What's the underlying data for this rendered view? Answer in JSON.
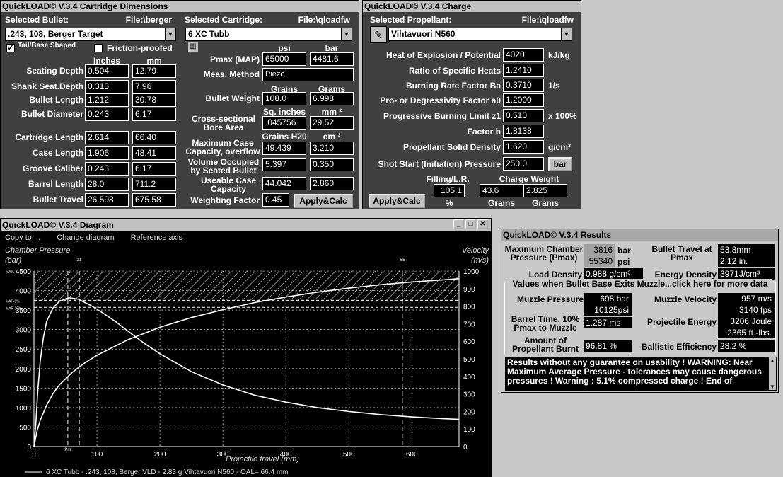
{
  "cartridge_window": {
    "title": "QuickLOAD© V.3.4 Cartridge Dimensions",
    "selected_bullet_label": "Selected Bullet:",
    "bullet_file": "File:\\berger",
    "bullet_value": ".243, 108, Berger Target",
    "tail_base_label": "Tail/Base Shaped",
    "tail_base_checked": "✓",
    "friction_label": "Friction-proofed",
    "col_inches": "Inches",
    "col_mm": "mm",
    "rows": [
      {
        "label": "Seating Depth",
        "in": "0.504",
        "mm": "12.79"
      },
      {
        "label": "Shank Seat.Depth",
        "in": "0.313",
        "mm": "7.96"
      },
      {
        "label": "Bullet Length",
        "in": "1.212",
        "mm": "30.78"
      },
      {
        "label": "Bullet Diameter",
        "in": "0.243",
        "mm": "6.17"
      },
      {
        "label": "Cartridge Length",
        "in": "2.614",
        "mm": "66.40"
      },
      {
        "label": "Case Length",
        "in": "1.906",
        "mm": "48.41"
      },
      {
        "label": "Groove Caliber",
        "in": "0.243",
        "mm": "6.17"
      },
      {
        "label": "Barrel Length",
        "in": "28.0",
        "mm": "711.2"
      },
      {
        "label": "Bullet Travel",
        "in": "26.598",
        "mm": "675.58"
      }
    ],
    "selected_cartridge_label": "Selected Cartridge:",
    "cartridge_file": "File:\\qloadfw",
    "cartridge_value": "6 XC Tubb",
    "col_psi": "psi",
    "col_bar": "bar",
    "pmax_label": "Pmax (MAP)",
    "pmax_psi": "65000",
    "pmax_bar": "4481.6",
    "meas_label": "Meas. Method",
    "meas_value": "Piezo",
    "col_grains": "Grains",
    "col_grams": "Grams",
    "bw_label": "Bullet Weight",
    "bw_grains": "108.0",
    "bw_grams": "6.998",
    "col_sqin": "Sq. inches",
    "col_mm2": "mm ²",
    "bore_label": "Cross-sectional Bore Area",
    "bore_sqin": ".045756",
    "bore_mm2": "29.52",
    "col_grh2o": "Grains H20",
    "col_cm3": "cm ³",
    "maxcap_label": "Maximum Case Capacity, overflow",
    "maxcap_gr": "49.439",
    "maxcap_cm3": "3.210",
    "volocc_label": "Volume Occupied by Seated Bullet",
    "volocc_gr": "5.397",
    "volocc_cm3": "0.350",
    "useable_label": "Useable Case Capacity",
    "useable_gr": "44.042",
    "useable_cm3": "2.860",
    "weighting_label": "Weighting Factor",
    "weighting_value": "0.45",
    "apply_label": "Apply&Calc"
  },
  "charge_window": {
    "title": "QuickLOAD© V.3.4 Charge",
    "selected_label": "Selected Propellant:",
    "file": "File:\\qloadfw",
    "propellant": "Vihtavuori N560",
    "rows": [
      {
        "label": "Heat of Explosion / Potential",
        "value": "4020",
        "unit": "kJ/kg"
      },
      {
        "label": "Ratio of Specific Heats",
        "value": "1.2410",
        "unit": ""
      },
      {
        "label": "Burning Rate Factor  Ba",
        "value": "0.3710",
        "unit": "1/s"
      },
      {
        "label": "Pro- or Degressivity Factor  a0",
        "value": "1.2000",
        "unit": ""
      },
      {
        "label": "Progressive Burning Limit z1",
        "value": "0.510",
        "unit": "x 100%"
      },
      {
        "label": "Factor  b",
        "value": "1.8138",
        "unit": ""
      },
      {
        "label": "Propellant Solid Density",
        "value": "1.620",
        "unit": "g/cm³"
      },
      {
        "label": "Shot Start (Initiation) Pressure",
        "value": "250.0",
        "unit": "bar"
      }
    ],
    "filling_label": "Filling/L.R.",
    "charge_weight_label": "Charge Weight",
    "filling_value": "105.1",
    "filling_unit": "%",
    "cw_grains": "43.6",
    "cw_grains_unit": "Grains",
    "cw_grams": "2.825",
    "cw_grams_unit": "Grams",
    "apply_label": "Apply&Calc"
  },
  "diagram_window": {
    "title": "QuickLOAD© V.3.4 Diagram",
    "menu": [
      "Copy to....",
      "Change diagram",
      "Reference axis"
    ],
    "left_axis_title": "Chamber Pressure",
    "left_axis_unit": "(bar)",
    "right_axis_title": "Velocity",
    "right_axis_unit": "(m/s)",
    "x_axis_title": "Projectile travel (mm)",
    "legend": "6 XC Tubb - .243, 108, Berger VLD - 2.83 g Vihtavuori N560 - OAL= 66.4 mm",
    "marker_max": "MAX.",
    "marker_map": "MAP-5%",
    "marker_map2": "MAP-20%",
    "marker_z1": "z1",
    "marker_pm": "Pm",
    "marker_s": "S5"
  },
  "chart_data": {
    "type": "line",
    "xlabel": "Projectile travel (mm)",
    "ylabel": "Chamber Pressure (bar)",
    "y2label": "Velocity (m/s)",
    "xlim": [
      0,
      675
    ],
    "ylim": [
      0,
      4500
    ],
    "y2lim": [
      0,
      1000
    ],
    "xticks": [
      0,
      100,
      200,
      300,
      400,
      500,
      600
    ],
    "yticks": [
      0,
      500,
      1000,
      1500,
      2000,
      2500,
      3000,
      3500,
      4000,
      4500
    ],
    "y2ticks": [
      0,
      100,
      200,
      300,
      400,
      500,
      600,
      700,
      800,
      900,
      1000
    ],
    "series": [
      {
        "axis": "left",
        "x": [
          0,
          3,
          6,
          10,
          15,
          20,
          30,
          40,
          55,
          70,
          90,
          110,
          130,
          150,
          175,
          200,
          250,
          300,
          350,
          400,
          450,
          500,
          550,
          600,
          650,
          675
        ],
        "values": [
          0,
          600,
          1400,
          2200,
          2800,
          3200,
          3550,
          3720,
          3816,
          3780,
          3620,
          3420,
          3200,
          2950,
          2650,
          2380,
          1920,
          1580,
          1320,
          1140,
          1000,
          900,
          820,
          760,
          715,
          698
        ]
      },
      {
        "axis": "right",
        "x": [
          0,
          5,
          10,
          20,
          30,
          40,
          60,
          80,
          100,
          150,
          200,
          250,
          300,
          350,
          400,
          450,
          500,
          550,
          600,
          650,
          675
        ],
        "values": [
          0,
          90,
          150,
          235,
          300,
          350,
          420,
          475,
          520,
          610,
          680,
          735,
          780,
          820,
          852,
          880,
          903,
          922,
          938,
          950,
          957
        ]
      }
    ],
    "grid": true
  },
  "results_window": {
    "title": "QuickLOAD© V.3.4 Results",
    "mcp_label": "Maximum Chamber Pressure (Pmax)",
    "mcp_bar": "3816",
    "mcp_bar_unit": "bar",
    "mcp_psi": "55340",
    "mcp_psi_unit": "psi",
    "travel_label": "Bullet Travel at Pmax",
    "travel_mm": "53.8",
    "travel_mm_unit": "mm",
    "travel_in": "2.12",
    "travel_in_unit": "in.",
    "load_density_label": "Load Density",
    "load_density": "0.988",
    "load_density_unit": "g/cm³",
    "energy_density_label": "Energy Density",
    "energy_density": "3971",
    "energy_density_unit": "J/cm³",
    "muzzle_header": "Values when Bullet Base Exits Muzzle...click here for more data",
    "muzzle_pressure_label": "Muzzle Pressure",
    "muzzle_pressure_bar": "698",
    "muzzle_pressure_bar_unit": "bar",
    "muzzle_pressure_psi": "10125",
    "muzzle_pressure_psi_unit": "psi",
    "muzzle_velocity_label": "Muzzle Velocity",
    "muzzle_velocity_ms": "957",
    "muzzle_velocity_ms_unit": "m/s",
    "muzzle_velocity_fps": "3140",
    "muzzle_velocity_fps_unit": "fps",
    "barrel_time_label": "Barrel Time, 10% Pmax to Muzzle",
    "barrel_time": "1.287",
    "barrel_time_unit": "ms",
    "energy_label": "Projectile Energy",
    "energy_j": "3206",
    "energy_j_unit": "Joule",
    "energy_ftlb": "2365",
    "energy_ftlb_unit": "ft.-lbs.",
    "burnt_label": "Amount of Propellant Burnt",
    "burnt": "96.81",
    "burnt_unit": "%",
    "efficiency_label": "Ballistic Efficiency",
    "efficiency": "28.2",
    "efficiency_unit": "%",
    "warning": "Results without any guarantee on usability !  WARNING: Near Maximum Average Pressure - tolerances may cause dangerous pressures !  Warning : 5.1% compressed charge !  End of"
  }
}
